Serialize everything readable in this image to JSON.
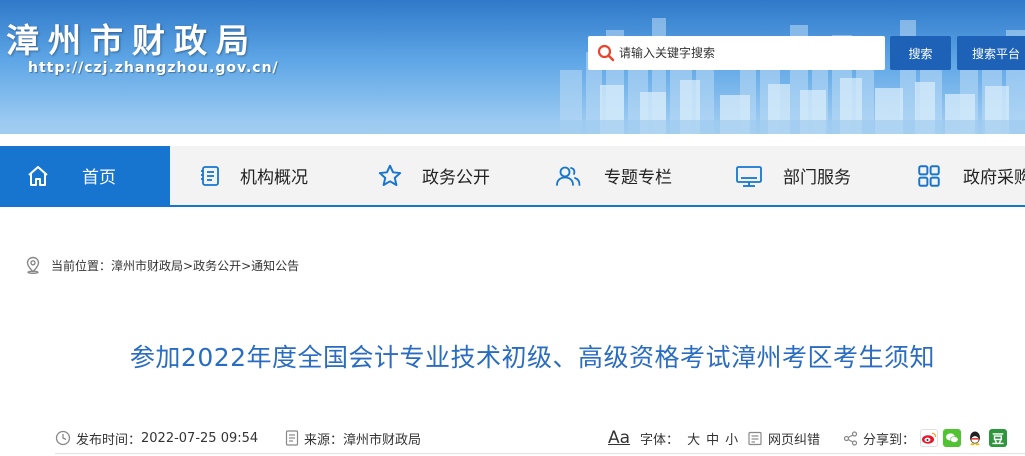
{
  "banner": {
    "title": "漳州市财政局",
    "url": "http://czj.zhangzhou.gov.cn/",
    "search": {
      "placeholder": "请输入关键字搜索"
    },
    "search_button": "搜索",
    "platform_button": "搜索平台"
  },
  "nav": {
    "items": [
      {
        "label": "首页",
        "icon": "home-icon"
      },
      {
        "label": "机构概况",
        "icon": "document-icon"
      },
      {
        "label": "政务公开",
        "icon": "star-icon"
      },
      {
        "label": "专题专栏",
        "icon": "users-icon"
      },
      {
        "label": "部门服务",
        "icon": "monitor-icon"
      },
      {
        "label": "政府采购",
        "icon": "grid-icon"
      }
    ],
    "active_index": 0
  },
  "breadcrumb": {
    "prefix": "当前位置：",
    "path": "漳州市财政局>政务公开>通知公告"
  },
  "article": {
    "title": "参加2022年度全国会计专业技术初级、高级资格考试漳州考区考生须知",
    "publish_label": "发布时间：",
    "publish_time": "2022-07-25 09:54",
    "source_label": "来源：",
    "source": "漳州市财政局",
    "font_aa": "Aa",
    "font_label": "字体：",
    "font_sizes": [
      "大",
      "中",
      "小"
    ],
    "correction": "网页纠错",
    "share_label": "分享到："
  },
  "colors": {
    "nav_active": "#1775d0",
    "title_blue": "#2a6cc0",
    "button_blue": "#1d62b7"
  }
}
